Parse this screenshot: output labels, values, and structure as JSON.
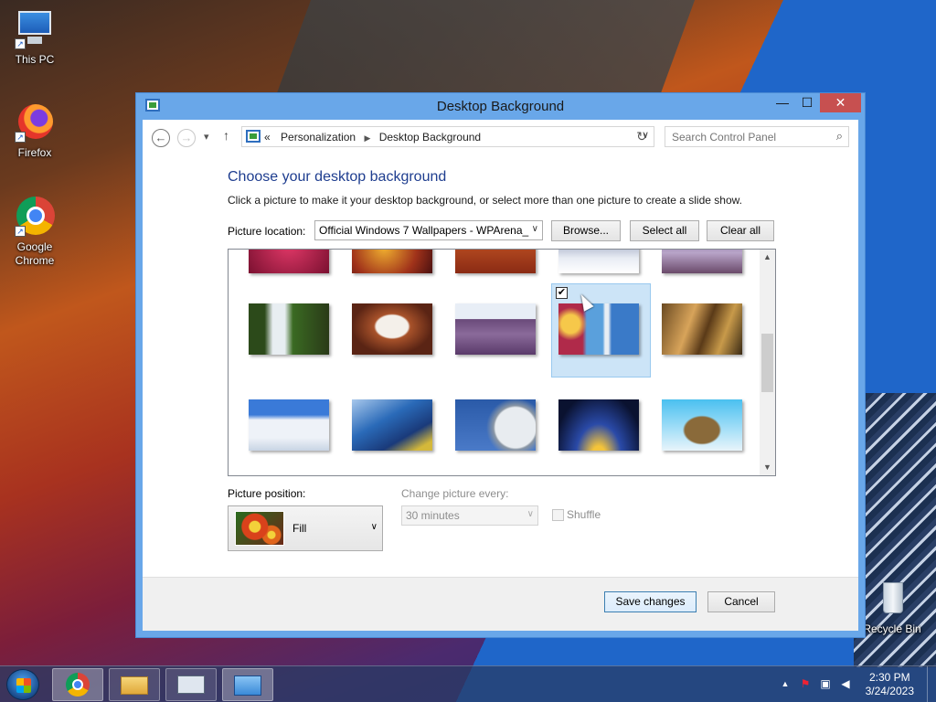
{
  "desktop": {
    "icons": [
      {
        "label": "This PC"
      },
      {
        "label": "Firefox"
      },
      {
        "label": "Google Chrome"
      },
      {
        "label": "Recycle Bin"
      }
    ]
  },
  "window": {
    "title": "Desktop Background",
    "controls": {
      "minimize": "—",
      "maximize": "☐",
      "close": "✕"
    }
  },
  "nav": {
    "back": "←",
    "forward": "→",
    "recent": "▾",
    "up": "↑",
    "breadcrumb_overflow": "«",
    "breadcrumb": [
      "Personalization",
      "Desktop Background"
    ],
    "breadcrumb_separator": "▶",
    "dropdown": "∨",
    "refresh": "↻",
    "search_placeholder": "Search Control Panel",
    "search_icon": "⌕"
  },
  "main": {
    "heading": "Choose your desktop background",
    "description": "Click a picture to make it your desktop background, or select more than one picture to create a slide show.",
    "picture_location_label": "Picture location:",
    "picture_location_value": "Official Windows 7 Wallpapers - WPArena_",
    "browse_label": "Browse...",
    "select_all_label": "Select all",
    "clear_all_label": "Clear all"
  },
  "gallery": {
    "selected_index": 8,
    "check_mark": "✔",
    "scroll_up": "▲",
    "scroll_down": "▼",
    "thumbnails": [
      {
        "alt": "magenta flower"
      },
      {
        "alt": "autumn leaves"
      },
      {
        "alt": "sunset canyon"
      },
      {
        "alt": "snowy trees"
      },
      {
        "alt": "purple mountains"
      },
      {
        "alt": "waterfall"
      },
      {
        "alt": "rock arch"
      },
      {
        "alt": "lavender field"
      },
      {
        "alt": "space needle"
      },
      {
        "alt": "golden rock"
      },
      {
        "alt": "white building"
      },
      {
        "alt": "blue glass building"
      },
      {
        "alt": "dotted dome"
      },
      {
        "alt": "night arches"
      },
      {
        "alt": "turtle island"
      }
    ]
  },
  "options": {
    "picture_position_label": "Picture position:",
    "picture_position_value": "Fill",
    "change_every_label": "Change picture every:",
    "change_every_value": "30 minutes",
    "shuffle_label": "Shuffle",
    "dropdown_arrow": "∨"
  },
  "footer": {
    "save_label": "Save changes",
    "cancel_label": "Cancel"
  },
  "taskbar": {
    "time": "2:30 PM",
    "date": "3/24/2023",
    "tray_arrow": "▲"
  }
}
